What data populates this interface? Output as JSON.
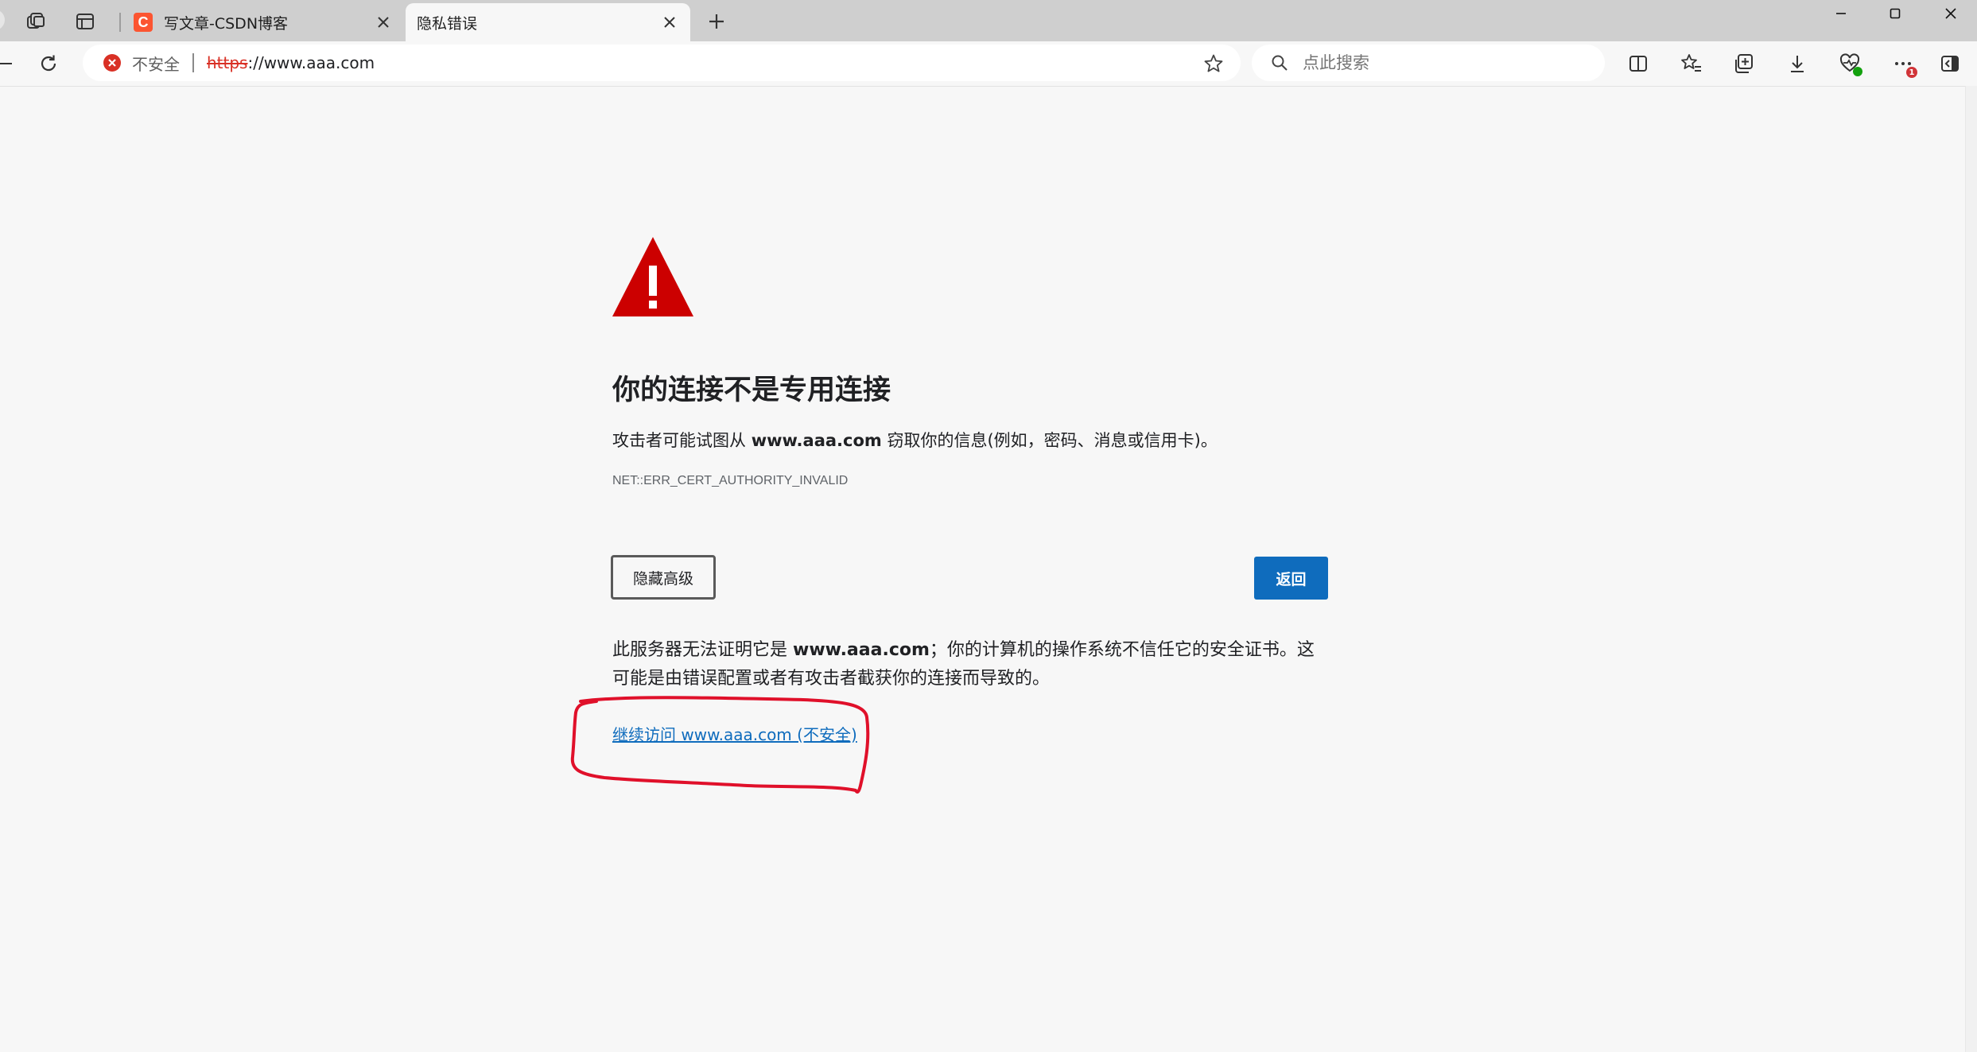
{
  "browser": {
    "tabs": [
      {
        "title": "写文章-CSDN博客",
        "favicon_letter": "C",
        "favicon_color": "#fc5531",
        "active": false
      },
      {
        "title": "隐私错误",
        "active": true
      }
    ],
    "address_bar": {
      "security_label": "不安全",
      "url_scheme": "https",
      "url_rest": "://www.aaa.com"
    },
    "search": {
      "placeholder": "点此搜索"
    },
    "menu_badge": "1"
  },
  "page": {
    "heading": "你的连接不是专用连接",
    "desc_prefix": "攻击者可能试图从 ",
    "desc_host": "www.aaa.com",
    "desc_suffix": " 窃取你的信息(例如，密码、消息或信用卡)。",
    "error_code": "NET::ERR_CERT_AUTHORITY_INVALID",
    "advanced_button": "隐藏高级",
    "back_button": "返回",
    "detail_prefix": "此服务器无法证明它是 ",
    "detail_host": "www.aaa.com",
    "detail_suffix": "；你的计算机的操作系统不信任它的安全证书。这可能是由错误配置或者有攻击者截获你的连接而导致的。",
    "proceed_link": "继续访问 www.aaa.com (不安全)"
  },
  "colors": {
    "warning_red": "#cc0000",
    "link_blue": "#0f6cbd",
    "annotation_red": "#e0102a"
  }
}
